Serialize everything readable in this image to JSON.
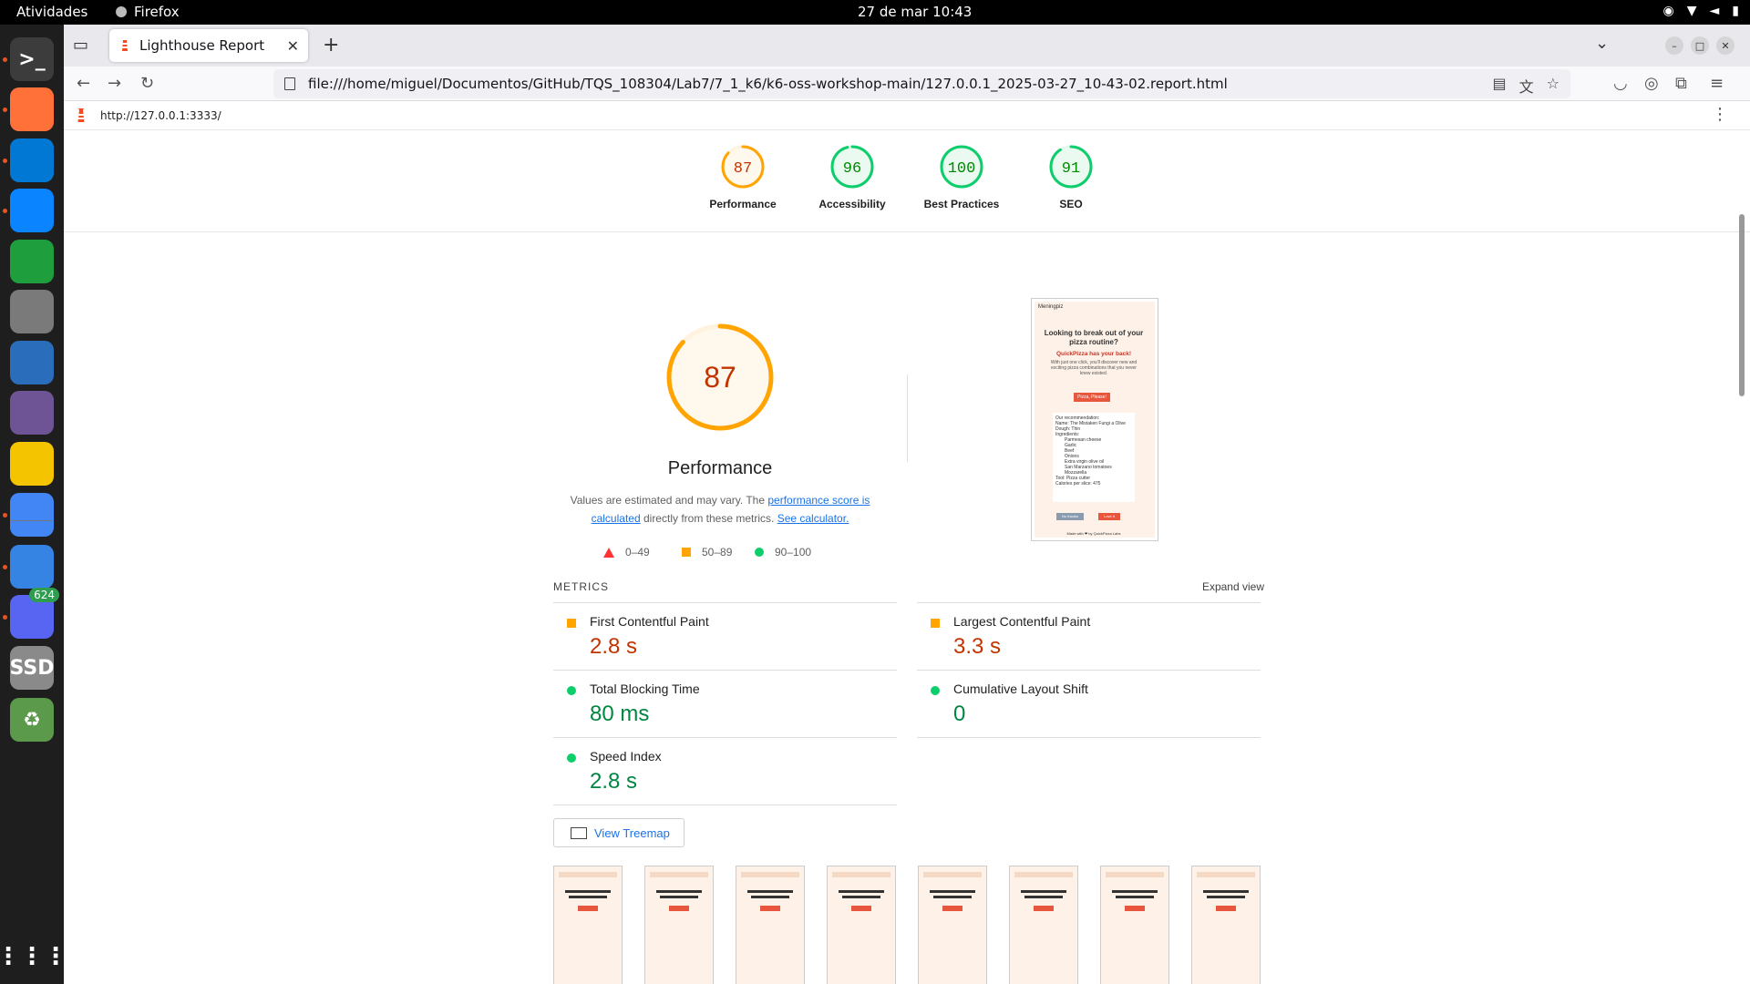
{
  "os": {
    "activities": "Atividades",
    "active_app": "Firefox",
    "clock": "27 de mar  10:43",
    "tray": [
      "discord-tray-icon",
      "wifi-icon",
      "volume-muted-icon",
      "battery-icon"
    ]
  },
  "dock": {
    "items": [
      {
        "name": "terminal",
        "label": ">_",
        "color": "#3c3c3c"
      },
      {
        "name": "firefox",
        "label": "",
        "color": "#ff7139"
      },
      {
        "name": "vscode",
        "label": "",
        "color": "#0078d4"
      },
      {
        "name": "thunderbird",
        "label": "",
        "color": "#0a84ff"
      },
      {
        "name": "libreoffice-calc",
        "label": "",
        "color": "#1e9e3c"
      },
      {
        "name": "files",
        "label": "",
        "color": "#7a7a7a"
      },
      {
        "name": "libreoffice-impress",
        "label": "",
        "color": "#2a6ebb"
      },
      {
        "name": "github-desktop",
        "label": "",
        "color": "#6e5494"
      },
      {
        "name": "rhythmbox",
        "label": "",
        "color": "#f5c400"
      },
      {
        "name": "chrome",
        "label": "",
        "color": "#4285f4"
      },
      {
        "name": "text-editor",
        "label": "",
        "color": "#3584e4"
      },
      {
        "name": "discord",
        "label": "",
        "color": "#5865f2",
        "badge": "624"
      },
      {
        "name": "ssd",
        "label": "SSD",
        "color": "#8a8a8a"
      },
      {
        "name": "trash",
        "label": "♻",
        "color": "#5a9a4a"
      }
    ]
  },
  "browser": {
    "tab_title": "Lighthouse Report",
    "url": "file:///home/miguel/Documentos/GitHub/TQS_108304/Lab7/7_1_k6/k6-oss-workshop-main/127.0.0.1_2025-03-27_10-43-02.report.html"
  },
  "report": {
    "page_url": "http://127.0.0.1:3333/",
    "scores": [
      {
        "label": "Performance",
        "score": 87,
        "color": "#ffa400",
        "text_color": "#c33300"
      },
      {
        "label": "Accessibility",
        "score": 96,
        "color": "#0cce6b",
        "text_color": "#008800"
      },
      {
        "label": "Best Practices",
        "score": 100,
        "color": "#0cce6b",
        "text_color": "#008800"
      },
      {
        "label": "SEO",
        "score": 91,
        "color": "#0cce6b",
        "text_color": "#008800"
      }
    ],
    "perf": {
      "score": "87",
      "title": "Performance",
      "desc_prefix": "Values are estimated and may vary. The ",
      "desc_link1": "performance score is calculated",
      "desc_mid": " directly from these metrics. ",
      "desc_link2": "See calculator."
    },
    "legend": [
      "0–49",
      "50–89",
      "90–100"
    ],
    "screenshot_text": {
      "brand": "Meningpiz",
      "headline": "Looking to break out of your pizza routine?",
      "sub": "QuickPizza has your back!",
      "body": "With just one click, you'll discover new and exciting pizza combinations that you never knew existed.",
      "button": "Pizza, Please!",
      "rec_title": "Our recommendation:",
      "rec_name": "Name: The Mistaken Fungi a Olive",
      "dough": "Dough: Thin",
      "ingredients_label": "Ingredients:",
      "ingredients": [
        "Parmesan cheese",
        "Garlic",
        "Beef",
        "Onions",
        "Extra virgin olive oil",
        "San Marzano tomatoes",
        "Mozzarella"
      ],
      "tool": "Tool: Pizza cutter",
      "calories": "Calories per slice: 475",
      "btn1": "No thanks",
      "btn2": "Love it",
      "footer": "Made with ❤ by QuickPizza Labs"
    },
    "metrics_title": "METRICS",
    "expand_view": "Expand view",
    "metrics": [
      {
        "name": "First Contentful Paint",
        "value": "2.8 s",
        "rating": "orange"
      },
      {
        "name": "Largest Contentful Paint",
        "value": "3.3 s",
        "rating": "orange"
      },
      {
        "name": "Total Blocking Time",
        "value": "80 ms",
        "rating": "green"
      },
      {
        "name": "Cumulative Layout Shift",
        "value": "0",
        "rating": "green"
      },
      {
        "name": "Speed Index",
        "value": "2.8 s",
        "rating": "green"
      }
    ],
    "treemap_button": "View Treemap",
    "filmstrip_count": 8
  }
}
